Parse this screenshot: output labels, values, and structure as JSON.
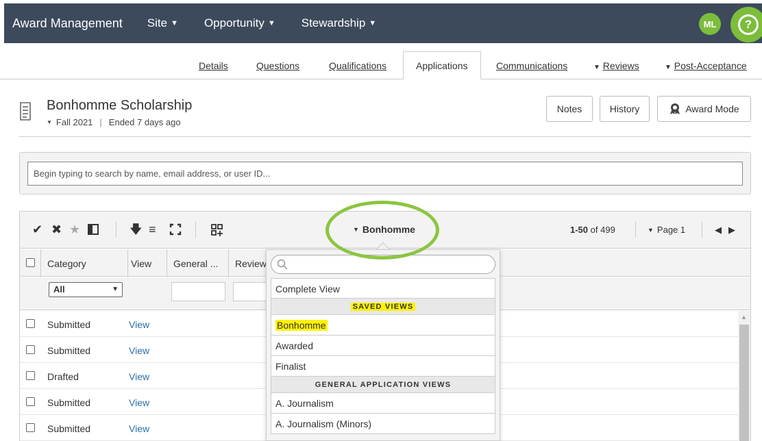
{
  "topbar": {
    "brand": "Award Management",
    "nav": [
      {
        "label": "Site"
      },
      {
        "label": "Opportunity"
      },
      {
        "label": "Stewardship"
      }
    ],
    "avatar_initials": "ML",
    "help_glyph": "?",
    "bg_color": "#3c4a5c",
    "accent_color": "#7cbd3c"
  },
  "tabs": {
    "details": "Details",
    "questions": "Questions",
    "qualifications": "Qualifications",
    "applications": "Applications",
    "communications": "Communications",
    "reviews": "Reviews",
    "post_acceptance": "Post-Acceptance"
  },
  "header": {
    "title": "Bonhomme Scholarship",
    "term": "Fall 2021",
    "separator": "|",
    "status": "Ended 7 days ago",
    "notes_label": "Notes",
    "history_label": "History",
    "award_mode_label": "Award Mode"
  },
  "search": {
    "placeholder": "Begin typing to search by name, email address, or user ID..."
  },
  "grid": {
    "current_view": "Bonhomme",
    "pager_range": "1-50",
    "pager_of": "of 499",
    "page_label": "Page 1",
    "columns": {
      "category": "Category",
      "view": "View",
      "general": "General ...",
      "review": "Review"
    },
    "category_filter": "All",
    "rows": [
      {
        "category": "Submitted",
        "view": "View"
      },
      {
        "category": "Submitted",
        "view": "View"
      },
      {
        "category": "Drafted",
        "view": "View"
      },
      {
        "category": "Submitted",
        "view": "View"
      },
      {
        "category": "Submitted",
        "view": "View"
      }
    ]
  },
  "dropdown": {
    "complete_view": "Complete View",
    "saved_views_header": "SAVED VIEWS",
    "saved_views": [
      "Bonhomme",
      "Awarded",
      "Finalist"
    ],
    "general_views_header": "GENERAL APPLICATION VIEWS",
    "general_views": [
      "A. Journalism",
      "A. Journalism (Minors)"
    ],
    "highlight_color": "#fff200"
  },
  "annotation_color": "#8cc541"
}
